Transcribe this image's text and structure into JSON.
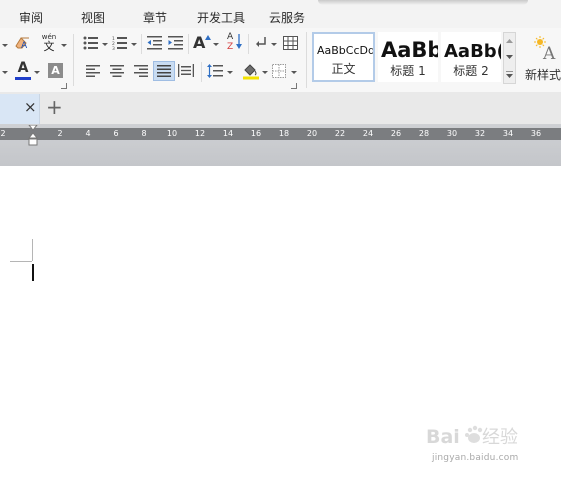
{
  "menu_tabs": [
    "审阅",
    "视图",
    "章节",
    "开发工具",
    "云服务"
  ],
  "ribbon": {
    "icons": {
      "clear_format": "eraser-icon",
      "phonetic_guide": "wen-phonetic-icon",
      "font_color_glyph": "A",
      "char_shading_glyph": "A",
      "font_color_hex": "#1f3ec9",
      "highlight_hex": "#f2e200"
    },
    "phonetic_glyph_top": "wén",
    "phonetic_glyph_bottom": "文",
    "grow_font_glyph": "A",
    "sort_glyph_top": "A",
    "sort_glyph_bottom": "Z",
    "styles": [
      {
        "sample": "AaBbCcDd",
        "label": "正文"
      },
      {
        "sample": "AaBb",
        "label": "标题 1"
      },
      {
        "sample": "AaBb(",
        "label": "标题 2"
      }
    ],
    "new_style_label": "新样式",
    "new_style_glyph": "A"
  },
  "doc_tabs": {
    "close_glyph": "×",
    "add_glyph": "+"
  },
  "ruler": {
    "ticks": [
      "2",
      "2",
      "4",
      "6",
      "8",
      "10",
      "12",
      "14",
      "16",
      "18",
      "20",
      "22",
      "24",
      "26",
      "28",
      "30",
      "32",
      "34",
      "36"
    ]
  },
  "watermark": {
    "text": "Baidu经验",
    "url": "jingyan.baidu.com"
  }
}
